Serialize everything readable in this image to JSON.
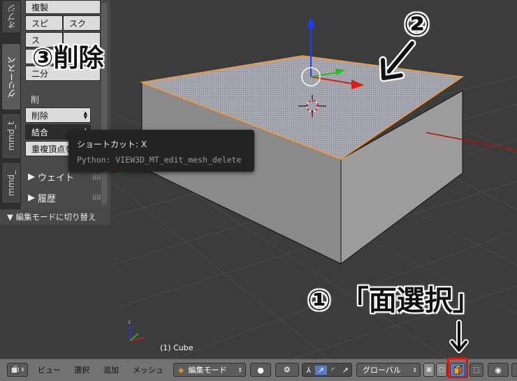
{
  "tool_shelf": {
    "tabs": [
      "オブジ",
      "グリースペ",
      "mmd_t",
      "mmd_"
    ],
    "buttons": {
      "duplicate": "複製",
      "spin": "スピ",
      "screw": "スク",
      "row3_left": "ス",
      "subdivide": "二分",
      "delete_section": "削",
      "delete": "削除",
      "join": "結合",
      "remove_doubles": "重複頂点を"
    },
    "panels": {
      "weight": "ウェイト",
      "history": "履歴"
    },
    "operator_footer": "▼ 編集モードに切り替え"
  },
  "tooltip": {
    "shortcut": "ショートカット: X",
    "python": "Python: VIEW3D_MT_edit_mesh_delete"
  },
  "viewport": {
    "object_label": "(1) Cube"
  },
  "annotations": {
    "step1": "① 「面選択」",
    "step2": "②",
    "step3": "③削除"
  },
  "header": {
    "menu_view": "ビュー",
    "menu_select": "選択",
    "menu_add": "追加",
    "menu_mesh": "メッシュ",
    "mode": "編集モード",
    "orientation": "グローバル"
  },
  "colors": {
    "selection_outline": "#ff9a2a",
    "x_axis": "#e01818",
    "y_axis": "#22c022",
    "z_axis": "#1a3cff",
    "highlight": "#e01010"
  }
}
